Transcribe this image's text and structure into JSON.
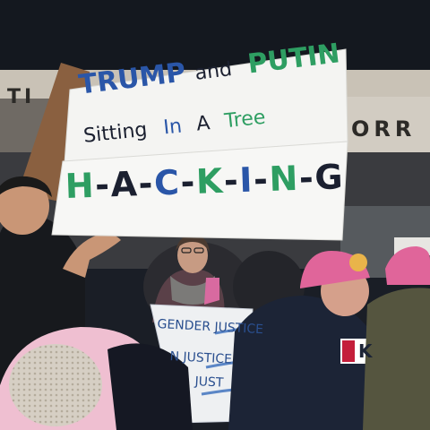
{
  "main_sign": {
    "line1_trump": "TRUMP",
    "line1_and": "and",
    "line1_putin": "PUTIN",
    "line2_sitting": "Sitting",
    "line2_in": "In",
    "line2_a": "A",
    "line2_tree": "Tree",
    "hacking_letters": [
      "H",
      "-",
      "A",
      "-",
      "C",
      "-",
      "K",
      "-",
      "I",
      "-",
      "N",
      "-",
      "G"
    ],
    "hacking_colors": [
      "#2e9e62",
      "#1b2030",
      "#1b2030",
      "#1b2030",
      "#2a56a8",
      "#1b2030",
      "#2e9e62",
      "#1b2030",
      "#2a56a8",
      "#1b2030",
      "#2e9e62",
      "#1b2030",
      "#1b2030"
    ]
  },
  "building_sign": {
    "left_text": "TI",
    "right_text": "ORR"
  },
  "small_sign": {
    "line1": "GENDER JUSTICE",
    "line2": "N JUSTICE",
    "line3": "JUST"
  },
  "jacket_logo_text": "K",
  "colors": {
    "blue_text": "#2a56a8",
    "green_text": "#2e9e62",
    "dark_text": "#1b2030",
    "pussyhat_pink": "#e0659a",
    "cardboard": "#8a6040"
  }
}
